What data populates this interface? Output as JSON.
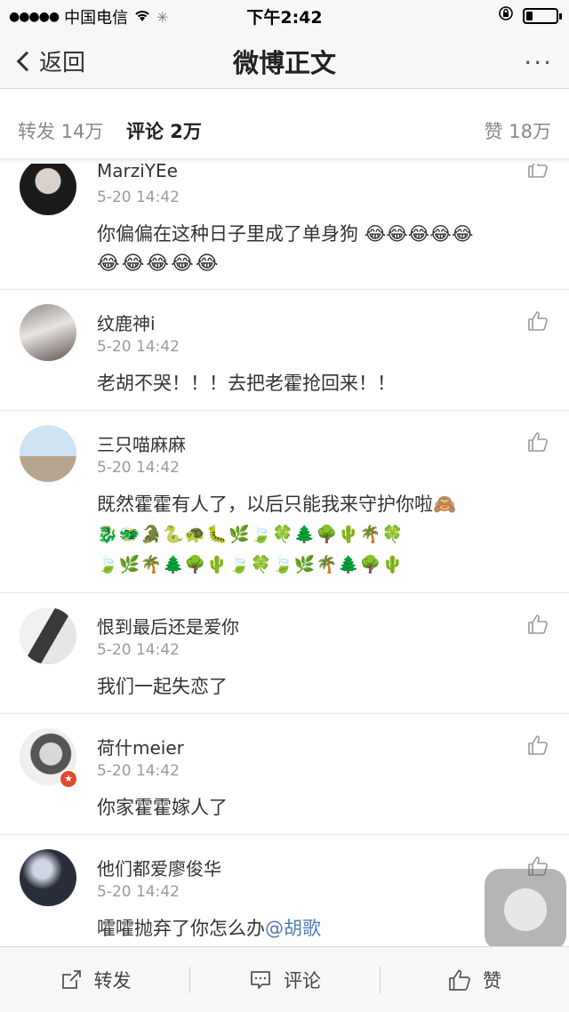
{
  "status_bar": {
    "signal": "●●●●●",
    "carrier": "中国电信",
    "wifi": "wifi-icon",
    "loading": "✳",
    "time": "下午2:42",
    "battery_level": 0.2
  },
  "nav": {
    "back_label": "返回",
    "title": "微博正文",
    "more": "···"
  },
  "tabs": {
    "repost": "转发 14万",
    "comment": "评论 2万",
    "like": "赞 18万"
  },
  "comments": [
    {
      "username": "MarziYEe",
      "time": "5-20 14:42",
      "text": "你偏偏在这种日子里成了单身狗",
      "emoji_line1": "😂😂😂😂😂",
      "emoji_line2": "😂😂😂😂😂"
    },
    {
      "username": "纹鹿神i",
      "time": "5-20 14:42",
      "text": "老胡不哭！！！去把老霍抢回来！！"
    },
    {
      "username": "三只喵麻麻",
      "time": "5-20 14:42",
      "text": "既然霍霍有人了，以后只能我来守护你啦🙈",
      "emoji_line1": "🐉🐲🐊🐍🐢🐛🌿🍃🍀🌲🌳🌵🌴🍀",
      "emoji_line2": "🍃🌿🌴🌲🌳🌵🍃🍀🍃🌿🌴🌲🌳🌵"
    },
    {
      "username": "恨到最后还是爱你",
      "time": "5-20 14:42",
      "text": "我们一起失恋了"
    },
    {
      "username": "荷什meier",
      "time": "5-20 14:42",
      "text": "你家霍霍嫁人了"
    },
    {
      "username": "他们都爱廖俊华",
      "time": "5-20 14:42",
      "text": "嚯嚯抛弃了你怎么办",
      "mention": "@胡歌"
    }
  ],
  "bottom_bar": {
    "repost": "转发",
    "comment": "评论",
    "like": "赞"
  },
  "colors": {
    "accent": "#ff8200",
    "mention": "#507daf"
  }
}
